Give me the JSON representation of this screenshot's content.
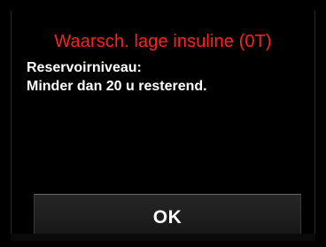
{
  "alert": {
    "title": "Waarsch. lage insuline (0T)",
    "message_line1": "Reservoirniveau:",
    "message_line2": "Minder dan 20 u resterend."
  },
  "buttons": {
    "ok_label": "OK"
  },
  "colors": {
    "background": "#000000",
    "title_text": "#ff2020",
    "body_text": "#ffffff",
    "button_face": "#202020"
  }
}
